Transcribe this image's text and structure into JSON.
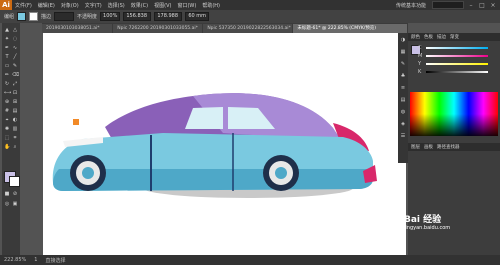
{
  "app": {
    "logo": "Ai",
    "mode_label": "传统基本功能"
  },
  "menu": {
    "items": [
      "文件(F)",
      "编辑(E)",
      "对象(O)",
      "文字(T)",
      "选择(S)",
      "效果(C)",
      "视图(V)",
      "窗口(W)",
      "帮助(H)"
    ]
  },
  "control_bar": {
    "selection_label": "编组",
    "stroke_label": "描边",
    "opacity_label": "不透明度",
    "opacity_value": "100%",
    "x_value": "156.838",
    "y_value": "178.988",
    "w_value": "60 mm"
  },
  "tabs": [
    {
      "label": "2019030103038051.ai*"
    },
    {
      "label": "Npic 7262200 20190301033055.ai*"
    },
    {
      "label": "Npic 537350 2019022822563034.ai*"
    },
    {
      "label": "未标题-61* @ 222.85% (CMYK/预览)"
    }
  ],
  "panels": {
    "color_tabs": [
      "颜色",
      "色板",
      "描边",
      "渐变"
    ],
    "channels": [
      "C",
      "M",
      "Y",
      "K"
    ],
    "layers_tabs": [
      "图层",
      "画板",
      "路径查找器"
    ]
  },
  "status": {
    "zoom": "222.85%",
    "page": "1",
    "tool": "直接选择"
  },
  "watermark": {
    "text": "Bai 经验",
    "sub": "jingyan.baidu.com"
  },
  "colors": {
    "car_body": "#7ac9e0",
    "car_roof": "#8a60b8",
    "accent": "#d8286a"
  }
}
